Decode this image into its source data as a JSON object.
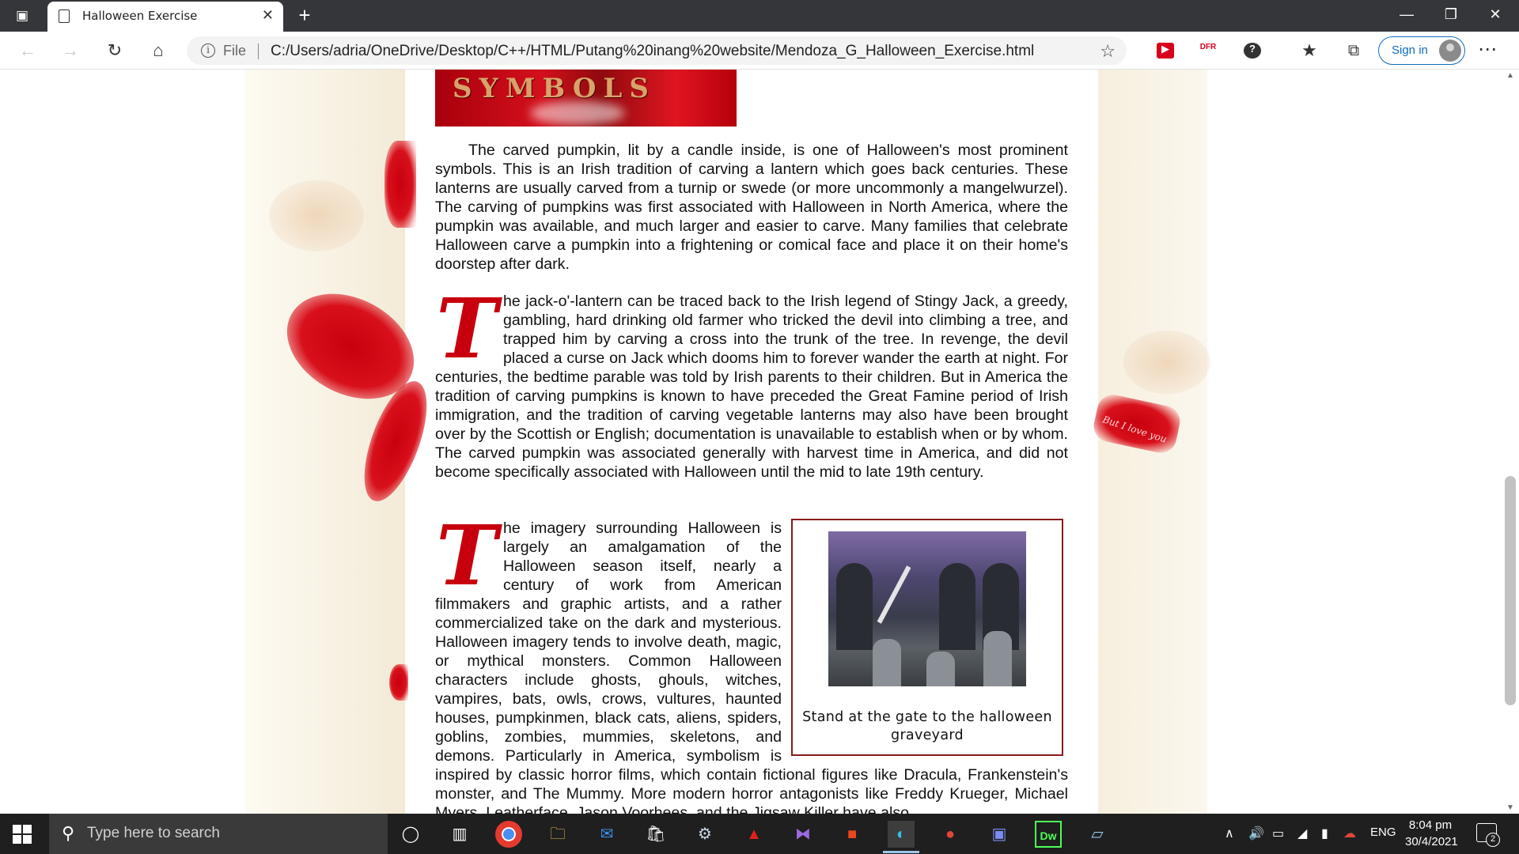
{
  "browser": {
    "tab_title": "Halloween Exercise",
    "file_label": "File",
    "url": "C:/Users/adria/OneDrive/Desktop/C++/HTML/Putang%20inang%20website/Mendoza_G_Halloween_Exercise.html",
    "sign_in_label": "Sign in",
    "icons": [
      "tab-actions-icon",
      "page-icon",
      "close-icon",
      "plus-icon",
      "minimize-icon",
      "restore-icon",
      "back-arrow-icon",
      "forward-arrow-icon",
      "refresh-icon",
      "home-icon",
      "info-icon",
      "add-favorite-icon",
      "favorites-icon",
      "collections-icon",
      "more-icon"
    ]
  },
  "page": {
    "banner_text": "SYMBOLS",
    "background_tag": "But I love you",
    "paragraph1": "The carved pumpkin, lit by a candle inside, is one of Halloween's most prominent symbols. This is an Irish tradition of carving a lantern which goes back centuries. These lanterns are usually carved from a turnip or swede (or more uncommonly a mangelwurzel). The carving of pumpkins was first associated with Halloween in North America, where the pumpkin was available, and much larger and easier to carve. Many families that celebrate Halloween carve a pumpkin into a frightening or comical face and place it on their home's doorstep after dark.",
    "dropcap": "T",
    "paragraph2": "he jack-o'-lantern can be traced back to the Irish legend of Stingy Jack, a greedy, gambling, hard drinking old farmer who tricked the devil into climbing a tree, and trapped him by carving a cross into the trunk of the tree. In revenge, the devil placed a curse on Jack which dooms him to forever wander the earth at night. For centuries, the bedtime parable was told by Irish parents to their children. But in America the tradition of carving pumpkins is known to have preceded the Great Famine period of Irish immigration, and the tradition of carving vegetable lanterns may also have been brought over by the Scottish or English; documentation is unavailable to establish when or by whom. The carved pumpkin was associated generally with harvest time in America, and did not become specifically associated with Halloween until the mid to late 19th century.",
    "paragraph3": "he imagery surrounding Halloween is largely an amalgamation of the Halloween season itself, nearly a century of work from American filmmakers and graphic artists, and a rather commercialized take on the dark and mysterious. Halloween imagery tends to involve death, magic, or mythical monsters. Common Halloween characters include ghosts, ghouls, witches, vampires, bats, owls, crows, vultures, haunted houses, pumpkinmen, black cats, aliens, spiders, goblins, zombies, mummies, skeletons, and demons. Particularly in America, symbolism is inspired by classic horror films, which contain fictional figures like Dracula, Frankenstein's monster, and The Mummy. More modern horror antagonists like Freddy Krueger, Michael Myers, Leatherface, Jason Voorhees, and the Jigsaw Killer have also",
    "figure_caption": "Stand at the gate to the halloween graveyard"
  },
  "taskbar": {
    "search_placeholder": "Type here to search",
    "language": "ENG",
    "time": "8:04 pm",
    "date": "30/4/2021",
    "notification_count": "2",
    "apps": [
      "cortana-icon",
      "task-view-icon",
      "chrome-icon",
      "file-explorer-icon",
      "mail-icon",
      "store-icon",
      "app-icon",
      "acrobat-icon",
      "visual-studio-icon",
      "office-icon",
      "edge-icon",
      "chrome-profile-icon",
      "discord-icon",
      "dreamweaver-icon",
      "notepad-icon"
    ]
  },
  "colors": {
    "accent_red": "#c8000d",
    "link_blue": "#0f6cbd",
    "titlebar": "#35363a",
    "taskbar": "#1f1f1f"
  }
}
